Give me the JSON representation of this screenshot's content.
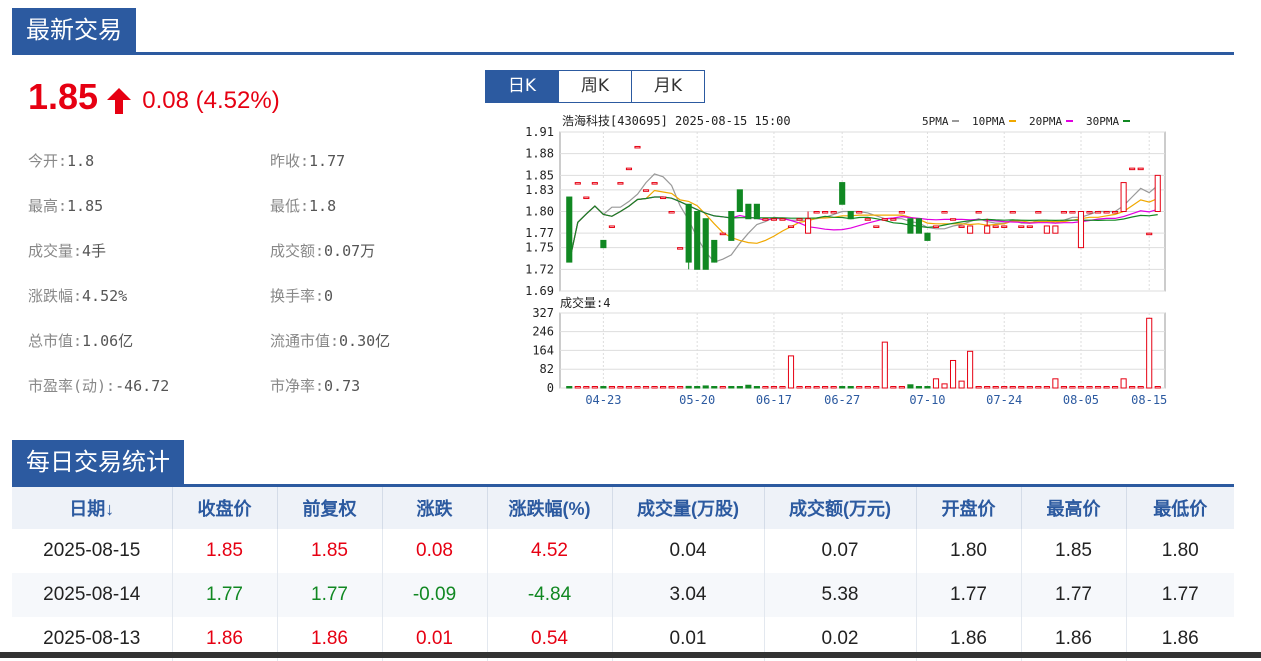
{
  "section1": {
    "title": "最新交易"
  },
  "quote": {
    "price": "1.85",
    "change": "0.08 (4.52%)",
    "color_up": "#e60012",
    "color_down": "#118822"
  },
  "stats": [
    {
      "label": "今开:",
      "value": "1.8"
    },
    {
      "label": "昨收:",
      "value": "1.77"
    },
    {
      "label": "最高:",
      "value": "1.85"
    },
    {
      "label": "最低:",
      "value": "1.8"
    },
    {
      "label": "成交量:",
      "value": "4手"
    },
    {
      "label": "成交额:",
      "value": "0.07万"
    },
    {
      "label": "涨跌幅:",
      "value": "4.52%"
    },
    {
      "label": "换手率:",
      "value": "0"
    },
    {
      "label": "总市值:",
      "value": "1.06亿"
    },
    {
      "label": "流通市值:",
      "value": "0.30亿"
    },
    {
      "label": "市盈率(动):",
      "value": "-46.72"
    },
    {
      "label": "市净率:",
      "value": "0.73"
    }
  ],
  "ktabs": [
    {
      "label": "日K",
      "active": true
    },
    {
      "label": "周K",
      "active": false
    },
    {
      "label": "月K",
      "active": false
    }
  ],
  "chart_data": {
    "type": "candlestick",
    "title": "浩海科技[430695] 2025-08-15 15:00",
    "legend": [
      {
        "name": "5PMA",
        "color": "#999999"
      },
      {
        "name": "10PMA",
        "color": "#f0a800"
      },
      {
        "name": "20PMA",
        "color": "#e000e0"
      },
      {
        "name": "30PMA",
        "color": "#118822"
      }
    ],
    "price_ticks": [
      "1.91",
      "1.88",
      "1.85",
      "1.83",
      "1.80",
      "1.77",
      "1.75",
      "1.72",
      "1.69"
    ],
    "ylim": [
      1.69,
      1.91
    ],
    "volume_label": "成交量:4",
    "volume_ticks": [
      "327",
      "246",
      "164",
      "82",
      "0"
    ],
    "volume_ylim": [
      0,
      327
    ],
    "x_ticks": [
      "04-23",
      "05-20",
      "06-17",
      "06-27",
      "07-10",
      "07-24",
      "08-05",
      "08-15"
    ],
    "up_color": "#e60012",
    "down_color": "#118822",
    "candles": [
      [
        1.82,
        1.73,
        1.82,
        1.73,
        2
      ],
      [
        1.84,
        1.84,
        1.84,
        1.84,
        1
      ],
      [
        1.82,
        1.82,
        1.82,
        1.82,
        4
      ],
      [
        1.84,
        1.84,
        1.84,
        1.84,
        2
      ],
      [
        1.76,
        1.75,
        1.76,
        1.75,
        2
      ],
      [
        1.78,
        1.78,
        1.78,
        1.78,
        2
      ],
      [
        1.84,
        1.84,
        1.84,
        1.84,
        2
      ],
      [
        1.86,
        1.86,
        1.86,
        1.86,
        2
      ],
      [
        1.89,
        1.89,
        1.89,
        1.89,
        1
      ],
      [
        1.83,
        1.83,
        1.83,
        1.83,
        2
      ],
      [
        1.84,
        1.84,
        1.84,
        1.84,
        2
      ],
      [
        1.82,
        1.82,
        1.82,
        1.82,
        2
      ],
      [
        1.8,
        1.8,
        1.8,
        1.8,
        2
      ],
      [
        1.75,
        1.75,
        1.75,
        1.75,
        2
      ],
      [
        1.81,
        1.73,
        1.81,
        1.72,
        7
      ],
      [
        1.8,
        1.72,
        1.8,
        1.72,
        3
      ],
      [
        1.79,
        1.72,
        1.79,
        1.72,
        9
      ],
      [
        1.76,
        1.73,
        1.76,
        1.73,
        2
      ],
      [
        1.77,
        1.77,
        1.77,
        1.77,
        2
      ],
      [
        1.8,
        1.76,
        1.8,
        1.76,
        3
      ],
      [
        1.83,
        1.8,
        1.83,
        1.8,
        2
      ],
      [
        1.81,
        1.79,
        1.81,
        1.79,
        12
      ],
      [
        1.81,
        1.79,
        1.81,
        1.79,
        2
      ],
      [
        1.79,
        1.79,
        1.79,
        1.79,
        3
      ],
      [
        1.79,
        1.79,
        1.79,
        1.79,
        4
      ],
      [
        1.79,
        1.79,
        1.79,
        1.79,
        2
      ],
      [
        1.78,
        1.78,
        1.78,
        1.78,
        140
      ],
      [
        1.79,
        1.79,
        1.79,
        1.79,
        2
      ],
      [
        1.77,
        1.79,
        1.8,
        1.77,
        3
      ],
      [
        1.8,
        1.8,
        1.8,
        1.8,
        4
      ],
      [
        1.8,
        1.8,
        1.8,
        1.8,
        3
      ],
      [
        1.8,
        1.8,
        1.8,
        1.8,
        2
      ],
      [
        1.84,
        1.81,
        1.84,
        1.81,
        4
      ],
      [
        1.8,
        1.79,
        1.8,
        1.79,
        3
      ],
      [
        1.8,
        1.8,
        1.8,
        1.8,
        2
      ],
      [
        1.79,
        1.79,
        1.79,
        1.79,
        3
      ],
      [
        1.78,
        1.78,
        1.78,
        1.78,
        2
      ],
      [
        1.79,
        1.79,
        1.79,
        1.79,
        200
      ],
      [
        1.79,
        1.79,
        1.79,
        1.79,
        2
      ],
      [
        1.8,
        1.8,
        1.8,
        1.8,
        4
      ],
      [
        1.79,
        1.77,
        1.79,
        1.77,
        14
      ],
      [
        1.79,
        1.77,
        1.79,
        1.77,
        3
      ],
      [
        1.77,
        1.76,
        1.77,
        1.76,
        2
      ],
      [
        1.78,
        1.78,
        1.78,
        1.78,
        40
      ],
      [
        1.8,
        1.8,
        1.8,
        1.8,
        18
      ],
      [
        1.79,
        1.79,
        1.79,
        1.79,
        120
      ],
      [
        1.78,
        1.78,
        1.78,
        1.78,
        30
      ],
      [
        1.77,
        1.78,
        1.78,
        1.77,
        160
      ],
      [
        1.8,
        1.8,
        1.8,
        1.8,
        2
      ],
      [
        1.77,
        1.78,
        1.79,
        1.77,
        2
      ],
      [
        1.78,
        1.78,
        1.78,
        1.78,
        2
      ],
      [
        1.78,
        1.78,
        1.78,
        1.78,
        3
      ],
      [
        1.8,
        1.8,
        1.8,
        1.8,
        2
      ],
      [
        1.78,
        1.78,
        1.78,
        1.78,
        2
      ],
      [
        1.78,
        1.78,
        1.78,
        1.78,
        2
      ],
      [
        1.8,
        1.8,
        1.8,
        1.8,
        2
      ],
      [
        1.77,
        1.78,
        1.78,
        1.77,
        2
      ],
      [
        1.77,
        1.78,
        1.78,
        1.77,
        40
      ],
      [
        1.8,
        1.8,
        1.8,
        1.8,
        2
      ],
      [
        1.8,
        1.8,
        1.8,
        1.8,
        2
      ],
      [
        1.75,
        1.8,
        1.8,
        1.75,
        2
      ],
      [
        1.8,
        1.8,
        1.8,
        1.8,
        2
      ],
      [
        1.8,
        1.8,
        1.8,
        1.8,
        2
      ],
      [
        1.8,
        1.8,
        1.8,
        1.8,
        2
      ],
      [
        1.8,
        1.8,
        1.8,
        1.8,
        4
      ],
      [
        1.8,
        1.84,
        1.84,
        1.8,
        40
      ],
      [
        1.86,
        1.86,
        1.86,
        1.86,
        2
      ],
      [
        1.86,
        1.86,
        1.86,
        1.86,
        2
      ],
      [
        1.77,
        1.77,
        1.77,
        1.77,
        304
      ],
      [
        1.8,
        1.85,
        1.85,
        1.8,
        4
      ]
    ]
  },
  "section2": {
    "title": "每日交易统计"
  },
  "table": {
    "headers": [
      "日期↓",
      "收盘价",
      "前复权",
      "涨跌",
      "涨跌幅(%)",
      "成交量(万股)",
      "成交额(万元)",
      "开盘价",
      "最高价",
      "最低价"
    ],
    "rows": [
      {
        "dir": "up",
        "cells": [
          "2025-08-15",
          "1.85",
          "1.85",
          "0.08",
          "4.52",
          "0.04",
          "0.07",
          "1.80",
          "1.85",
          "1.80"
        ]
      },
      {
        "dir": "down",
        "cells": [
          "2025-08-14",
          "1.77",
          "1.77",
          "-0.09",
          "-4.84",
          "3.04",
          "5.38",
          "1.77",
          "1.77",
          "1.77"
        ]
      },
      {
        "dir": "up",
        "cells": [
          "2025-08-13",
          "1.86",
          "1.86",
          "0.01",
          "0.54",
          "0.01",
          "0.02",
          "1.86",
          "1.86",
          "1.86"
        ]
      }
    ]
  }
}
